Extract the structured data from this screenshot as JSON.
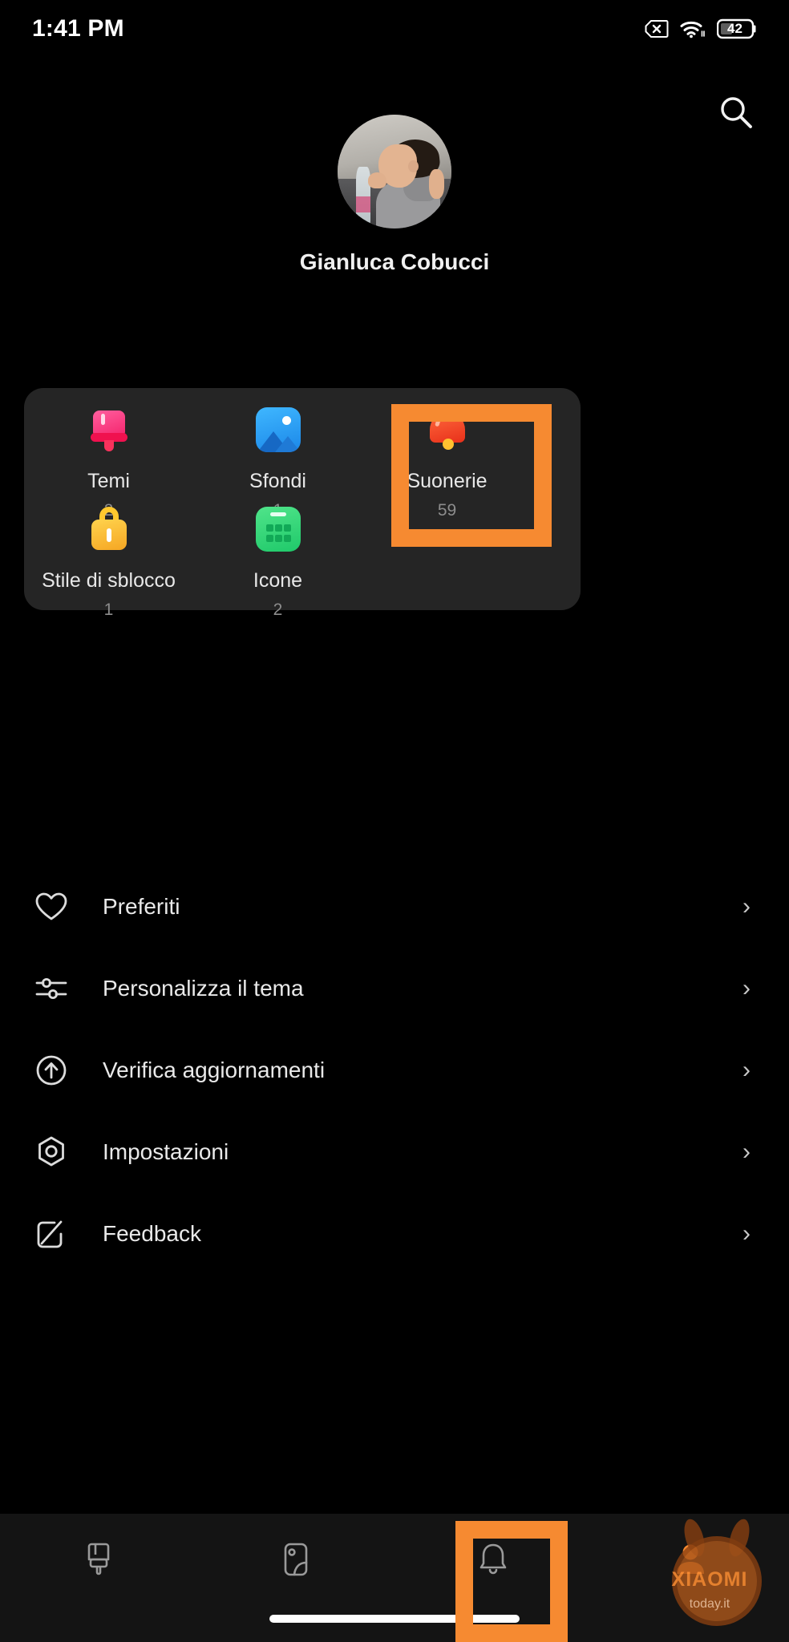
{
  "status_bar": {
    "time": "1:41 PM",
    "sim_icon": "sim-card-x-icon",
    "wifi_icon": "wifi-icon",
    "battery_icon": "battery-icon",
    "battery_level": "42"
  },
  "header": {
    "search_icon": "search-icon"
  },
  "profile": {
    "avatar": "user-avatar",
    "name": "Gianluca Cobucci"
  },
  "quick_card": {
    "items": [
      {
        "label": "Temi",
        "count": "2",
        "icon": "paintbrush-icon",
        "highlighted": false
      },
      {
        "label": "Sfondi",
        "count": "1",
        "icon": "wallpaper-icon",
        "highlighted": false
      },
      {
        "label": "Suonerie",
        "count": "59",
        "icon": "bell-icon",
        "highlighted": true
      },
      {
        "label": "Stile di sblocco",
        "count": "1",
        "icon": "lock-icon",
        "highlighted": false
      },
      {
        "label": "Icone",
        "count": "2",
        "icon": "app-icons-icon",
        "highlighted": false
      }
    ]
  },
  "menu": {
    "items": [
      {
        "label": "Preferiti",
        "icon": "heart-icon",
        "chevron": "›"
      },
      {
        "label": "Personalizza il tema",
        "icon": "sliders-icon",
        "chevron": "›"
      },
      {
        "label": "Verifica aggiornamenti",
        "icon": "update-arrow-icon",
        "chevron": "›"
      },
      {
        "label": "Impostazioni",
        "icon": "settings-gear-icon",
        "chevron": "›"
      },
      {
        "label": "Feedback",
        "icon": "edit-square-icon",
        "chevron": "›"
      }
    ]
  },
  "bottom_nav": {
    "items": [
      {
        "icon": "themes-brush-icon",
        "active": false
      },
      {
        "icon": "wallpaper-nav-icon",
        "active": false
      },
      {
        "icon": "ringtone-bell-icon",
        "active": false
      },
      {
        "icon": "profile-person-icon",
        "active": true
      }
    ]
  },
  "watermark": {
    "brand": "XIAOMI",
    "site": "today.it"
  },
  "colors": {
    "highlight": "#f68a31",
    "card_bg": "#252525",
    "page_bg": "#000000",
    "nav_bg": "#141414",
    "text_primary": "#e9e9e9",
    "text_secondary": "#8d8d8d"
  },
  "annotations": {
    "highlight_boxes": [
      {
        "target": "Suonerie",
        "color": "#f68a31"
      },
      {
        "target": "profile-tab",
        "color": "#f68a31"
      }
    ]
  }
}
